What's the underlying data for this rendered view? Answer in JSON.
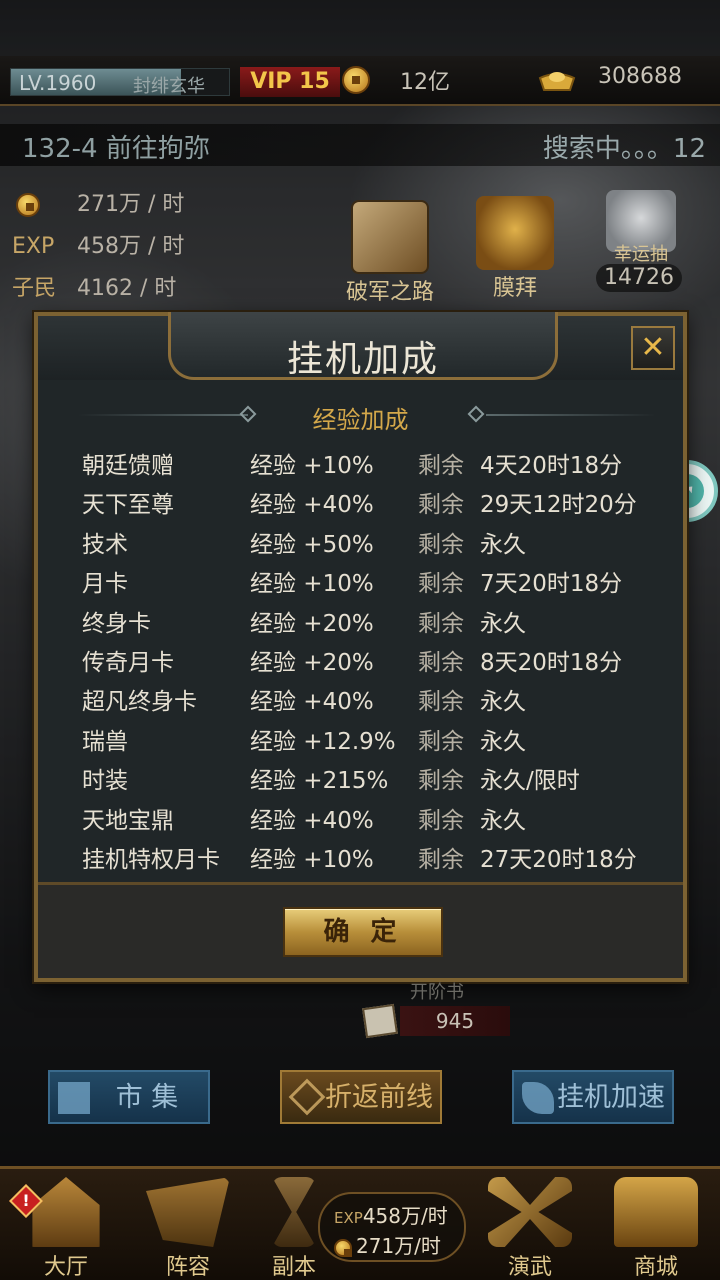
{
  "status_bar": {
    "level": "LV.1960",
    "level_progress": 0.78,
    "player_name": "封绯玄华",
    "vip": "VIP 15",
    "copper": "12亿",
    "gold": "308688"
  },
  "stage": {
    "current": "132-4 前往拘弥",
    "search_status": "搜索中。。。12"
  },
  "rates": [
    {
      "label": "",
      "icon": "copper-coin-icon",
      "value": "271万 / 时"
    },
    {
      "label": "EXP",
      "value": "458万 / 时"
    },
    {
      "label": "子民",
      "value": "4162 / 时"
    }
  ],
  "top_icons": {
    "pojun": "破军之路",
    "mobai": "膜拜",
    "xingyun": "幸运抽",
    "xingyun_count": "14726"
  },
  "dialog": {
    "title": "挂机加成",
    "section_title": "经验加成",
    "confirm_label": "确 定",
    "rows": [
      {
        "source": "朝廷馈赠",
        "exp": "经验 +10%",
        "remain": "剩余",
        "time": "4天20时18分"
      },
      {
        "source": "天下至尊",
        "exp": "经验 +40%",
        "remain": "剩余",
        "time": "29天12时20分"
      },
      {
        "source": "技术",
        "exp": "经验 +50%",
        "remain": "剩余",
        "time": "永久"
      },
      {
        "source": "月卡",
        "exp": "经验 +10%",
        "remain": "剩余",
        "time": "7天20时18分"
      },
      {
        "source": "终身卡",
        "exp": "经验 +20%",
        "remain": "剩余",
        "time": "永久"
      },
      {
        "source": "传奇月卡",
        "exp": "经验 +20%",
        "remain": "剩余",
        "time": "8天20时18分"
      },
      {
        "source": "超凡终身卡",
        "exp": "经验 +40%",
        "remain": "剩余",
        "time": "永久"
      },
      {
        "source": "瑞兽",
        "exp": "经验 +12.9%",
        "remain": "剩余",
        "time": "永久"
      },
      {
        "source": "时装",
        "exp": "经验 +215%",
        "remain": "剩余",
        "time": "永久/限时"
      },
      {
        "source": "天地宝鼎",
        "exp": "经验 +40%",
        "remain": "剩余",
        "time": "永久"
      },
      {
        "source": "挂机特权月卡",
        "exp": "经验 +10%",
        "remain": "剩余",
        "time": "27天20时18分"
      }
    ]
  },
  "below": {
    "faint_label": "开阶书",
    "book_count": "945"
  },
  "actions": {
    "market": "市 集",
    "return": "折返前线",
    "speed": "挂机加速"
  },
  "bottom_nav": {
    "hall": "大厅",
    "lineup": "阵容",
    "dungeon": "副本",
    "drill": "演武",
    "shop": "商城",
    "alert": "!",
    "exp_label": "EXP",
    "exp_rate": "458万/时",
    "copper_rate": "271万/时"
  },
  "colors": {
    "accent_gold": "#d4a84a",
    "panel_bg": "#202628",
    "border_gold": "#7c6232"
  }
}
